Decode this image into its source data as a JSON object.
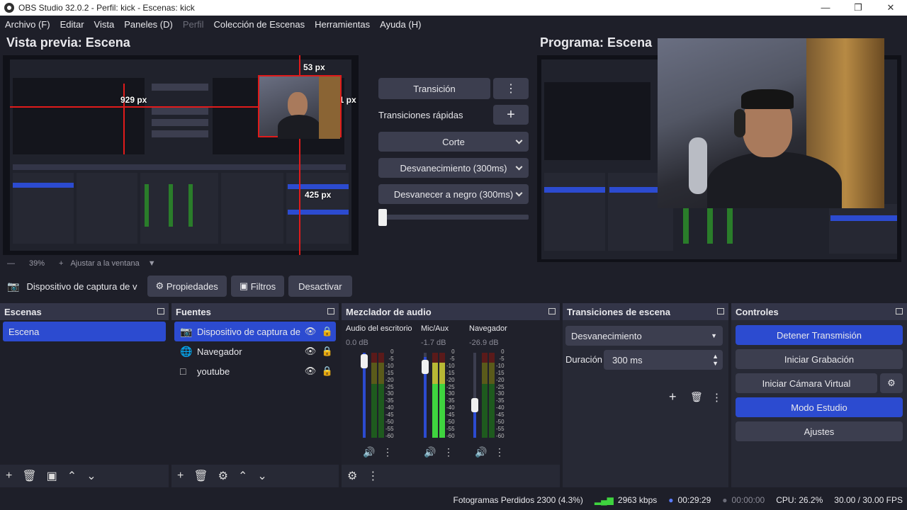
{
  "window": {
    "title": "OBS Studio 32.0.2 - Perfil: kick - Escenas: kick"
  },
  "menu": [
    "Archivo (F)",
    "Editar",
    "Vista",
    "Paneles (D)",
    "Perfil",
    "Colección de Escenas",
    "Herramientas",
    "Ayuda (H)"
  ],
  "preview": {
    "title": "Vista previa: Escena",
    "zoom": "39%",
    "fit_label": "Ajustar a la ventana",
    "px_labels": [
      "53 px",
      "929 px",
      "31 px",
      "425 px"
    ]
  },
  "program": {
    "title": "Programa: Escena"
  },
  "transitions_mid": {
    "transition_label": "Transición",
    "quick_label": "Transiciones rápidas",
    "items": [
      "Corte",
      "Desvanecimiento (300ms)",
      "Desvanecer a negro (300ms)"
    ]
  },
  "context": {
    "source_name": "Dispositivo de captura de v",
    "props": "Propiedades",
    "filters": "Filtros",
    "deactivate": "Desactivar"
  },
  "scenes": {
    "title": "Escenas",
    "items": [
      "Escena"
    ]
  },
  "sources": {
    "title": "Fuentes",
    "items": [
      "Dispositivo de captura de v",
      "Navegador",
      "youtube"
    ]
  },
  "mixer": {
    "title": "Mezclador de audio",
    "channels": [
      {
        "name": "Audio del escritorio",
        "db": "0.0 dB"
      },
      {
        "name": "Mic/Aux",
        "db": "-1.7 dB"
      },
      {
        "name": "Navegador",
        "db": "-26.9 dB"
      }
    ],
    "ticks": [
      "0",
      "-5",
      "-10",
      "-15",
      "-20",
      "-25",
      "-30",
      "-35",
      "-40",
      "-45",
      "-50",
      "-55",
      "-60"
    ]
  },
  "scene_transitions": {
    "title": "Transiciones de escena",
    "selected": "Desvanecimiento",
    "duration_label": "Duración",
    "duration_value": "300 ms"
  },
  "controls": {
    "title": "Controles",
    "stop_stream": "Detener Transmisión",
    "start_rec": "Iniciar Grabación",
    "virtual_cam": "Iniciar Cámara Virtual",
    "studio_mode": "Modo Estudio",
    "settings": "Ajustes"
  },
  "status": {
    "dropped": "Fotogramas Perdidos 2300 (4.3%)",
    "bitrate": "2963 kbps",
    "stream_time": "00:29:29",
    "rec_time": "00:00:00",
    "cpu": "CPU: 26.2%",
    "fps": "30.00 / 30.00 FPS"
  },
  "colors": {
    "accent": "#2c4bd0",
    "bg": "#1e1f29",
    "panel": "#272935",
    "button": "#3c3e4f",
    "guide": "#e01b1b"
  }
}
